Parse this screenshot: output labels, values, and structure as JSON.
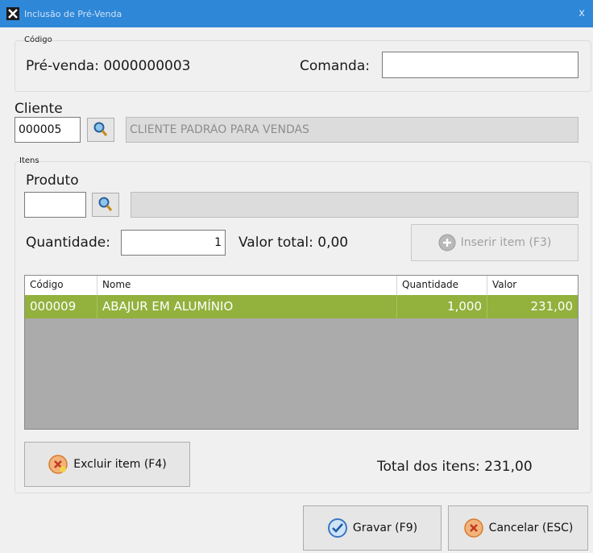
{
  "window": {
    "title": "Inclusão de Pré-Venda",
    "close": "x"
  },
  "codigo_group": {
    "caption": "Código",
    "prevenda_label": "Pré-venda: 0000000003",
    "comanda_label": "Comanda:",
    "comanda_value": ""
  },
  "cliente": {
    "label": "Cliente",
    "code": "000005",
    "name": "CLIENTE PADRÃO PARA VENDAS"
  },
  "itens_group": {
    "caption": "Itens",
    "produto_label": "Produto",
    "produto_value": "",
    "produto_desc": "",
    "quantidade_label": "Quantidade:",
    "quantidade_value": "1",
    "valor_total": "Valor total: 0,00",
    "inserir_button": "Inserir item (F3)"
  },
  "grid": {
    "columns": [
      "Código",
      "Nome",
      "Quantidade",
      "Valor"
    ],
    "rows": [
      {
        "codigo": "000009",
        "nome": "ABAJUR EM ALUMÍNIO",
        "quantidade": "1,000",
        "valor": "231,00"
      }
    ]
  },
  "excluir_button": "Excluir item (F4)",
  "total_itens": "Total dos itens: 231,00",
  "gravar_button": "Gravar (F9)",
  "cancelar_button": "Cancelar (ESC)",
  "colors": {
    "titlebar": "#2f87d8",
    "selected_row": "#92b13d"
  }
}
